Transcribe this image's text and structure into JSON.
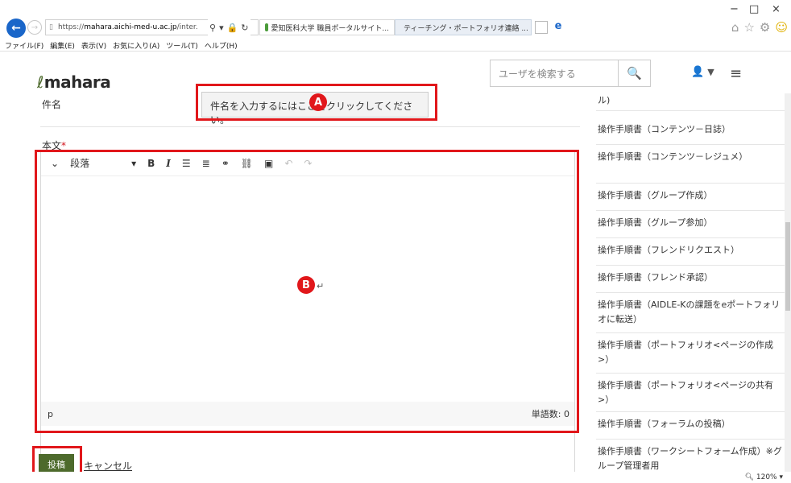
{
  "browser": {
    "address_prefix": "https://",
    "address_host": "mahara.aichi-med-u.ac.jp",
    "address_suffix": "/inter.",
    "tabs": [
      {
        "label": "愛知医科大学 職員ポータルサイト..."
      },
      {
        "label": "ティーチング・ポートフォリオ連絡 ..."
      }
    ],
    "tab_close": "×",
    "window_minimize": "−",
    "window_maximize": "□",
    "window_close": "×",
    "menu": [
      "ファイル(F)",
      "編集(E)",
      "表示(V)",
      "お気に入り(A)",
      "ツール(T)",
      "ヘルプ(H)"
    ],
    "zoom": "120%"
  },
  "header": {
    "logo": "mahara",
    "search_placeholder": "ユーザを検索する"
  },
  "form": {
    "subject_label": "件名",
    "subject_placeholder": "件名を入力するにはここをクリックしてください。",
    "body_label": "本文",
    "required_mark": "*",
    "format_label": "段落",
    "path_label": "p",
    "word_count_label": "単語数: 0",
    "post_button": "投稿",
    "cancel_link": "キャンセル"
  },
  "annotations": {
    "a": "A",
    "b": "B"
  },
  "sidebar": {
    "items": [
      "ル)",
      "操作手順書（コンテンツ－日誌）",
      "操作手順書（コンテンツ－レジュメ）",
      "操作手順書（グループ作成）",
      "操作手順書（グループ参加）",
      "操作手順書（フレンドリクエスト）",
      "操作手順書（フレンド承認）",
      "操作手順書（AIDLE-Kの課題をeポートフォリオに転送）",
      "操作手順書（ポートフォリオ<ページの作成>）",
      "操作手順書（ポートフォリオ<ページの共有>）",
      "操作手順書（フォーラムの投稿）",
      "操作手順書（ワークシートフォーム作成）※グループ管理者用"
    ]
  }
}
